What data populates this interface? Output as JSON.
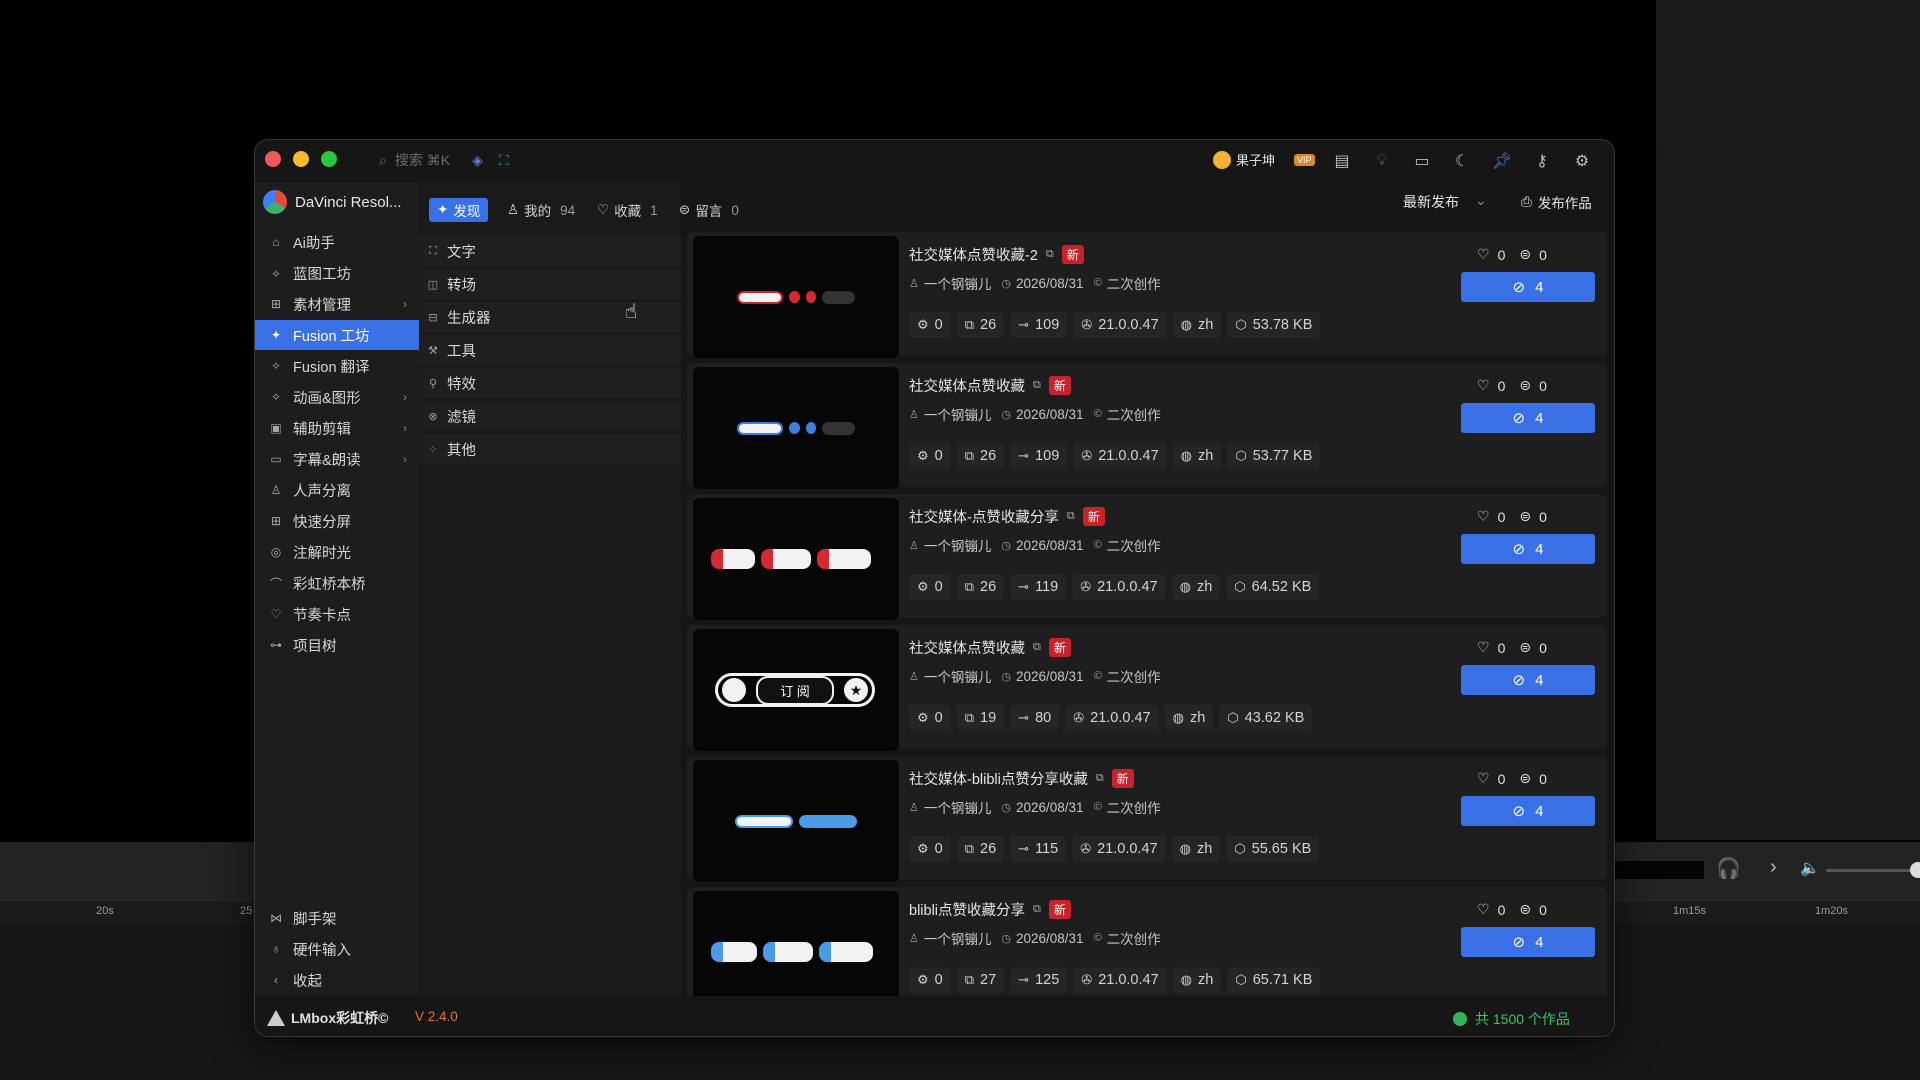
{
  "background": {
    "ruler_ticks": [
      {
        "label": "20s"
      },
      {
        "label": "25"
      },
      {
        "label": "1m15s"
      },
      {
        "label": "1m20s"
      }
    ]
  },
  "window": {
    "search_placeholder": "搜索 ⌘K",
    "user_name": "果子坤",
    "vip_label": "VIP",
    "app_title": "DaVinci Resol...",
    "accent_color": "#3970e6",
    "new_badge_color": "#c8232b"
  },
  "tabs": [
    {
      "label": "发现",
      "count": ""
    },
    {
      "label": "我的",
      "count": "94"
    },
    {
      "label": "收藏",
      "count": "1"
    },
    {
      "label": "留言",
      "count": "0"
    }
  ],
  "sort_label": "最新发布",
  "publish_label": "发布作品",
  "sidebar": {
    "items": [
      {
        "label": "Ai助手",
        "icon": "robot-icon",
        "arrow": ""
      },
      {
        "label": "蓝图工坊",
        "icon": "blueprint-icon",
        "arrow": ""
      },
      {
        "label": "素材管理",
        "icon": "assets-icon",
        "arrow": "›"
      },
      {
        "label": "Fusion 工坊",
        "icon": "fusion-icon",
        "arrow": ""
      },
      {
        "label": "Fusion 翻译",
        "icon": "translate-icon",
        "arrow": ""
      },
      {
        "label": "动画&图形",
        "icon": "animation-icon",
        "arrow": "›"
      },
      {
        "label": "辅助剪辑",
        "icon": "clapper-icon",
        "arrow": "›"
      },
      {
        "label": "字幕&朗读",
        "icon": "subtitle-icon",
        "arrow": "›"
      },
      {
        "label": "人声分离",
        "icon": "voice-icon",
        "arrow": ""
      },
      {
        "label": "快速分屏",
        "icon": "grid-icon",
        "arrow": ""
      },
      {
        "label": "注解时光",
        "icon": "annotate-icon",
        "arrow": ""
      },
      {
        "label": "彩虹桥本桥",
        "icon": "rainbow-icon",
        "arrow": ""
      },
      {
        "label": "节奏卡点",
        "icon": "beat-icon",
        "arrow": ""
      },
      {
        "label": "项目树",
        "icon": "tree-icon",
        "arrow": ""
      }
    ],
    "bottom_items": [
      {
        "label": "脚手架",
        "icon": "scaffold-icon"
      },
      {
        "label": "硬件输入",
        "icon": "joystick-icon"
      },
      {
        "label": "收起",
        "icon": "chevron-left-icon"
      }
    ]
  },
  "categories": [
    {
      "label": "文字",
      "icon": "text-icon"
    },
    {
      "label": "转场",
      "icon": "transition-icon"
    },
    {
      "label": "生成器",
      "icon": "generator-icon"
    },
    {
      "label": "工具",
      "icon": "tool-icon"
    },
    {
      "label": "特效",
      "icon": "effect-icon"
    },
    {
      "label": "滤镜",
      "icon": "filter-icon"
    },
    {
      "label": "其他",
      "icon": "other-icon"
    }
  ],
  "cards": [
    {
      "title": "社交媒体点赞收藏-2",
      "badge": "新",
      "author": "一个钢镚儿",
      "date": "2026/08/31",
      "type": "二次创作",
      "stats": {
        "settings": "0",
        "copies": "26",
        "links": "109",
        "version": "21.0.0.47",
        "lang": "zh",
        "size": "53.78 KB"
      },
      "likes": "0",
      "comments": "0",
      "get_count": "4"
    },
    {
      "title": "社交媒体点赞收藏",
      "badge": "新",
      "author": "一个钢镚儿",
      "date": "2026/08/31",
      "type": "二次创作",
      "stats": {
        "settings": "0",
        "copies": "26",
        "links": "109",
        "version": "21.0.0.47",
        "lang": "zh",
        "size": "53.77 KB"
      },
      "likes": "0",
      "comments": "0",
      "get_count": "4"
    },
    {
      "title": "社交媒体-点赞收藏分享",
      "badge": "新",
      "author": "一个钢镚儿",
      "date": "2026/08/31",
      "type": "二次创作",
      "stats": {
        "settings": "0",
        "copies": "26",
        "links": "119",
        "version": "21.0.0.47",
        "lang": "zh",
        "size": "64.52 KB"
      },
      "likes": "0",
      "comments": "0",
      "get_count": "4"
    },
    {
      "title": "社交媒体点赞收藏",
      "badge": "新",
      "author": "一个钢镚儿",
      "date": "2026/08/31",
      "type": "二次创作",
      "stats": {
        "settings": "0",
        "copies": "19",
        "links": "80",
        "version": "21.0.0.47",
        "lang": "zh",
        "size": "43.62 KB"
      },
      "likes": "0",
      "comments": "0",
      "get_count": "4",
      "thumb_text": "订 阅"
    },
    {
      "title": "社交媒体-blibli点赞分享收藏",
      "badge": "新",
      "author": "一个钢镚儿",
      "date": "2026/08/31",
      "type": "二次创作",
      "stats": {
        "settings": "0",
        "copies": "26",
        "links": "115",
        "version": "21.0.0.47",
        "lang": "zh",
        "size": "55.65 KB"
      },
      "likes": "0",
      "comments": "0",
      "get_count": "4"
    },
    {
      "title": "blibli点赞收藏分享",
      "badge": "新",
      "author": "一个钢镚儿",
      "date": "2026/08/31",
      "type": "二次创作",
      "stats": {
        "settings": "0",
        "copies": "27",
        "links": "125",
        "version": "21.0.0.47",
        "lang": "zh",
        "size": "65.71 KB"
      },
      "likes": "0",
      "comments": "0",
      "get_count": "4"
    }
  ],
  "footer": {
    "brand": "LMbox彩虹桥©",
    "version": "V 2.4.0",
    "total": "共 1500 个作品"
  }
}
